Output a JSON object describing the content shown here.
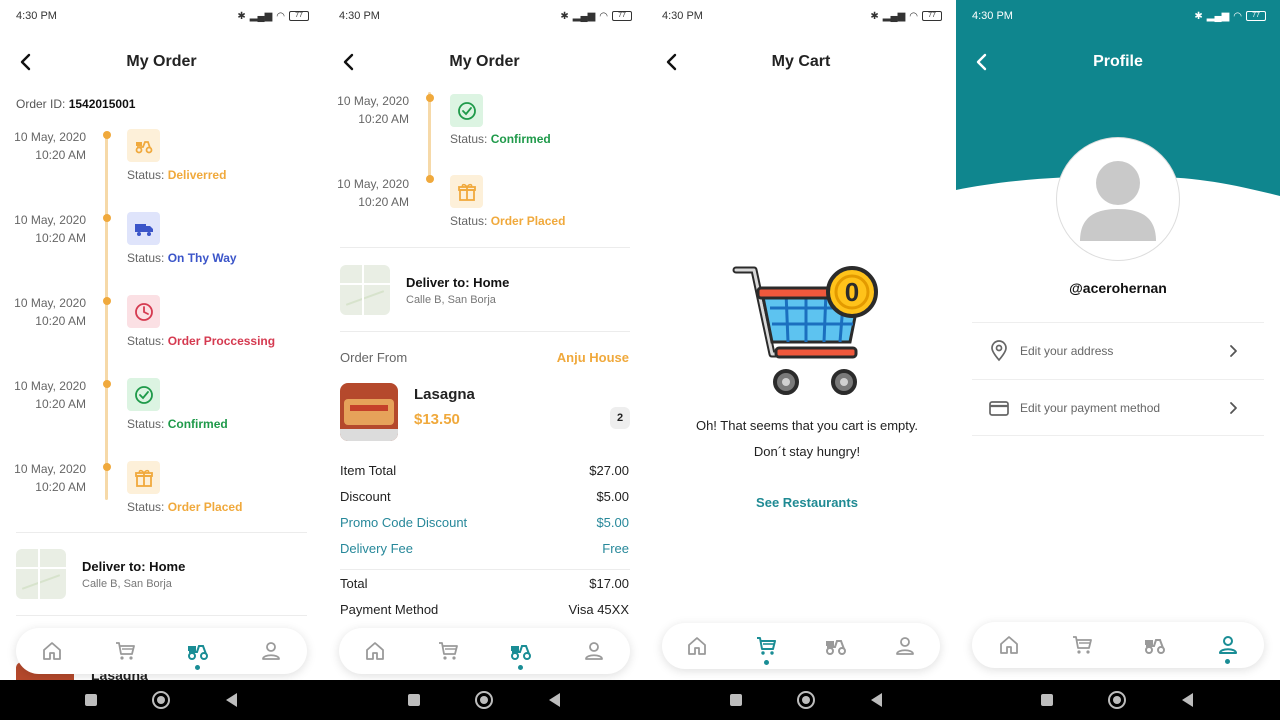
{
  "status_bar": {
    "time": "4:30 PM",
    "battery": "77"
  },
  "order_screen": {
    "title": "My Order",
    "order_id_label": "Order ID:",
    "order_id": "1542015001",
    "timeline": [
      {
        "date": "10 May, 2020",
        "time": "10:20 AM",
        "status_prefix": "Status:",
        "status": "Deliverred",
        "color": "#f0a93c",
        "bg": "#fdf0d9",
        "icon": "scooter-icon"
      },
      {
        "date": "10 May, 2020",
        "time": "10:20 AM",
        "status_prefix": "Status:",
        "status": "On Thy Way",
        "color": "#3b55c9",
        "bg": "#dfe4fb",
        "icon": "truck-icon"
      },
      {
        "date": "10 May, 2020",
        "time": "10:20 AM",
        "status_prefix": "Status:",
        "status": "Order Proccessing",
        "color": "#d53a50",
        "bg": "#fbe0e4",
        "icon": "clock-icon"
      },
      {
        "date": "10 May, 2020",
        "time": "10:20 AM",
        "status_prefix": "Status:",
        "status": "Confirmed",
        "color": "#1f9a4a",
        "bg": "#dcf4e2",
        "icon": "check-circle-icon"
      },
      {
        "date": "10 May, 2020",
        "time": "10:20 AM",
        "status_prefix": "Status:",
        "status": "Order Placed",
        "color": "#f0a93c",
        "bg": "#fdf0d9",
        "icon": "gift-icon"
      }
    ],
    "deliver_title": "Deliver to: Home",
    "deliver_address": "Calle B, San Borja",
    "order_from_label": "Order From",
    "restaurant": "Anju House",
    "item_name": "Lasagna",
    "item_price": "$13.50",
    "item_qty": "2",
    "summary": [
      {
        "label": "Item Total",
        "value": "$27.00",
        "teal": false
      },
      {
        "label": "Discount",
        "value": "$5.00",
        "teal": false
      },
      {
        "label": "Promo Code Discount",
        "value": "$5.00",
        "teal": true
      },
      {
        "label": "Delivery Fee",
        "value": "Free",
        "teal": true
      }
    ],
    "total_label": "Total",
    "total_value": "$17.00",
    "payment_label": "Payment Method",
    "payment_value": "Visa 45XX"
  },
  "cart_screen": {
    "title": "My Cart",
    "empty_line1": "Oh! That seems that you cart is empty.",
    "empty_line2": "Don´t stay hungry!",
    "cta": "See Restaurants",
    "coin_digit": "0"
  },
  "profile_screen": {
    "title": "Profile",
    "username": "@acerohernan",
    "menu": [
      {
        "label": "Edit your address",
        "icon": "location-pin-icon"
      },
      {
        "label": "Edit your payment method",
        "icon": "credit-card-icon"
      }
    ]
  },
  "nav": [
    "home-icon",
    "cart-icon",
    "scooter-icon",
    "user-icon"
  ],
  "colors": {
    "teal": "#0f868e",
    "orange": "#f0a93c",
    "nav_active": "#1a8d95",
    "nav_inactive": "#9a9a9a"
  }
}
